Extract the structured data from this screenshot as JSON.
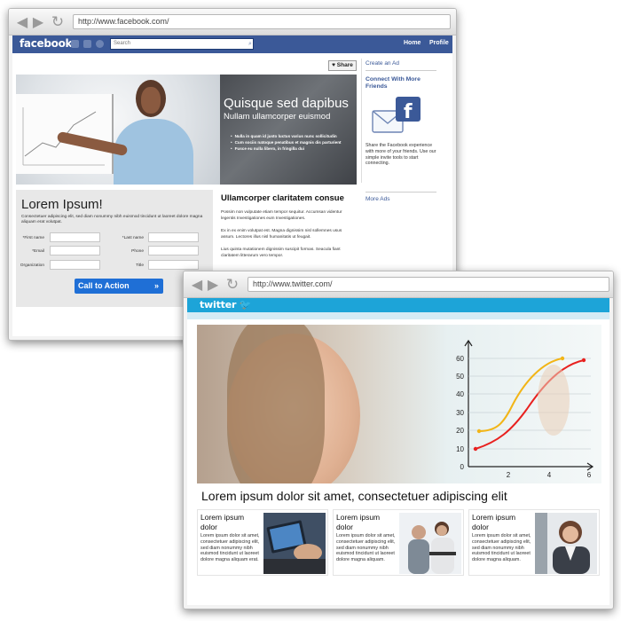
{
  "facebook_window": {
    "url": "http://www.facebook.com/",
    "logo": "facebook",
    "search_placeholder": "Search",
    "nav": {
      "home": "Home",
      "profile": "Profile"
    },
    "share_label": "Share",
    "hero": {
      "title": "Quisque sed dapibus",
      "subtitle": "Nullam ullamcorper euismod",
      "bullets": [
        "Nulla in quam id justo luctus varius nunc sollicitudin",
        "Cum sociis natoque penatibus et magnis dis parturient",
        "Fusce eu nulla libero, in fringilla dui"
      ]
    },
    "form": {
      "title": "Lorem Ipsum!",
      "description": "Consectetuer adipiscing elit, sed diam nonummy nibh euismod tincidunt ut laoreet dolore magna aliquam erat volutpat.",
      "fields": {
        "first_name": "*First name",
        "last_name": "*Last name",
        "email": "*Email",
        "phone": "Phone",
        "organization": "Organization",
        "title": "Title"
      },
      "cta_label": "Call to Action",
      "cta_arrow": "»"
    },
    "article": {
      "title": "Ullamcorper claritatem consue",
      "paragraphs": [
        "Possim non vulputate etiam tempor sequitur. Accumsan videntur legentis Investigationes eum Investigationes.",
        "Ex in ex enim volutpat est. Magna dignissim nisl sollemnes usus assum. Lectores illus nisl humanitatis ut feugait.",
        "Lius quinta mutationem dignissim suscipit formas. Seacula fiant claritatem litterarum vero tempor."
      ]
    },
    "sidebar": {
      "create_ad": "Create an Ad",
      "connect_heading": "Connect With More Friends",
      "connect_text": "Share the Facebook experience with more of your friends. Use our simple invite tools to start connecting.",
      "more_ads": "More Ads"
    }
  },
  "twitter_window": {
    "url": "http://www.twitter.com/",
    "logo": "twitter",
    "chart_ticks_y": [
      "60",
      "50",
      "40",
      "30",
      "20",
      "10",
      "0"
    ],
    "chart_ticks_x": [
      "2",
      "4",
      "6"
    ],
    "headline": "Lorem ipsum dolor sit amet, consectetuer adipiscing elit",
    "cards": [
      {
        "title": "Lorem ipsum dolor",
        "body": "Lorem ipsum dolor sit amet, consectetuer adipiscing elit, sed diam nonummy nibh euismod tincidunt ut laoreet dolore magna aliquam erat."
      },
      {
        "title": "Lorem ipsum dolor",
        "body": "Lorem ipsum dolor sit amet, consectetuer adipiscing elit, sed diam nonummy nibh euismod tincidunt ut laoreet dolore magna aliquam."
      },
      {
        "title": "Lorem ipsum dolor",
        "body": "Lorem ipsum dolor sit amet, consectetuer adipiscing elit, sed diam nonummy nibh euismod tincidunt ut laoreet dolore magna aliquam."
      }
    ]
  },
  "colors": {
    "facebook_blue": "#3b5998",
    "twitter_blue": "#1da4d8",
    "cta_blue": "#1f6fd6",
    "chart_red": "#e8211f",
    "chart_yellow": "#f2b517"
  }
}
